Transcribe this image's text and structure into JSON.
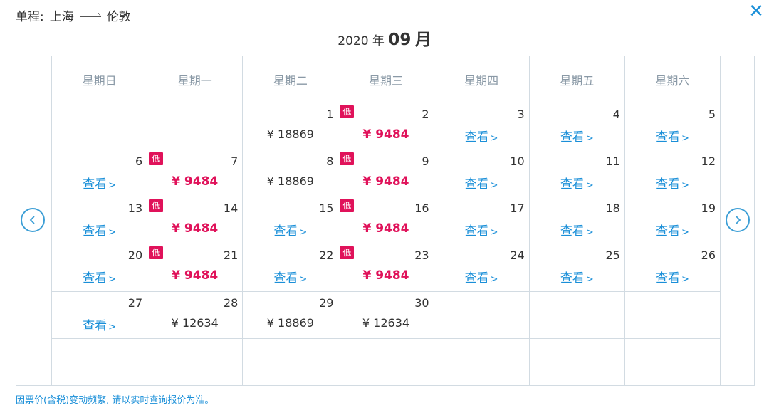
{
  "route": {
    "label": "单程:",
    "from": "上海",
    "to": "伦敦"
  },
  "title": {
    "year": "2020 年",
    "month": "09",
    "month_unit": "月"
  },
  "weekdays": [
    "星期日",
    "星期一",
    "星期二",
    "星期三",
    "星期四",
    "星期五",
    "星期六"
  ],
  "low_label": "低",
  "view_label": "查看",
  "view_chevron": ">",
  "weeks": [
    [
      {
        "day": "",
        "type": "empty"
      },
      {
        "day": "",
        "type": "empty"
      },
      {
        "day": "1",
        "type": "price",
        "price": "¥ 18869"
      },
      {
        "day": "2",
        "type": "low",
        "price": "¥ 9484"
      },
      {
        "day": "3",
        "type": "view"
      },
      {
        "day": "4",
        "type": "view"
      },
      {
        "day": "5",
        "type": "view"
      }
    ],
    [
      {
        "day": "6",
        "type": "view"
      },
      {
        "day": "7",
        "type": "low",
        "price": "¥ 9484"
      },
      {
        "day": "8",
        "type": "price",
        "price": "¥ 18869"
      },
      {
        "day": "9",
        "type": "low",
        "price": "¥ 9484"
      },
      {
        "day": "10",
        "type": "view"
      },
      {
        "day": "11",
        "type": "view"
      },
      {
        "day": "12",
        "type": "view"
      }
    ],
    [
      {
        "day": "13",
        "type": "view"
      },
      {
        "day": "14",
        "type": "low",
        "price": "¥ 9484"
      },
      {
        "day": "15",
        "type": "view"
      },
      {
        "day": "16",
        "type": "low",
        "price": "¥ 9484"
      },
      {
        "day": "17",
        "type": "view"
      },
      {
        "day": "18",
        "type": "view"
      },
      {
        "day": "19",
        "type": "view"
      }
    ],
    [
      {
        "day": "20",
        "type": "view"
      },
      {
        "day": "21",
        "type": "low",
        "price": "¥ 9484"
      },
      {
        "day": "22",
        "type": "view"
      },
      {
        "day": "23",
        "type": "low",
        "price": "¥ 9484"
      },
      {
        "day": "24",
        "type": "view"
      },
      {
        "day": "25",
        "type": "view"
      },
      {
        "day": "26",
        "type": "view"
      }
    ],
    [
      {
        "day": "27",
        "type": "view"
      },
      {
        "day": "28",
        "type": "price",
        "price": "¥ 12634"
      },
      {
        "day": "29",
        "type": "price",
        "price": "¥ 18869"
      },
      {
        "day": "30",
        "type": "price",
        "price": "¥ 12634"
      },
      {
        "day": "",
        "type": "empty"
      },
      {
        "day": "",
        "type": "empty"
      },
      {
        "day": "",
        "type": "empty"
      }
    ],
    [
      {
        "day": "",
        "type": "empty"
      },
      {
        "day": "",
        "type": "empty"
      },
      {
        "day": "",
        "type": "empty"
      },
      {
        "day": "",
        "type": "empty"
      },
      {
        "day": "",
        "type": "empty"
      },
      {
        "day": "",
        "type": "empty"
      },
      {
        "day": "",
        "type": "empty"
      }
    ]
  ],
  "footer": "因票价(含税)变动频繁, 请以实时查询报价为准。",
  "icons": {
    "close": "close-icon",
    "prev": "chevron-left-icon",
    "next": "chevron-right-icon"
  },
  "colors": {
    "accent": "#1a8fd8",
    "low": "#e0125a",
    "border": "#d2dbe2"
  }
}
